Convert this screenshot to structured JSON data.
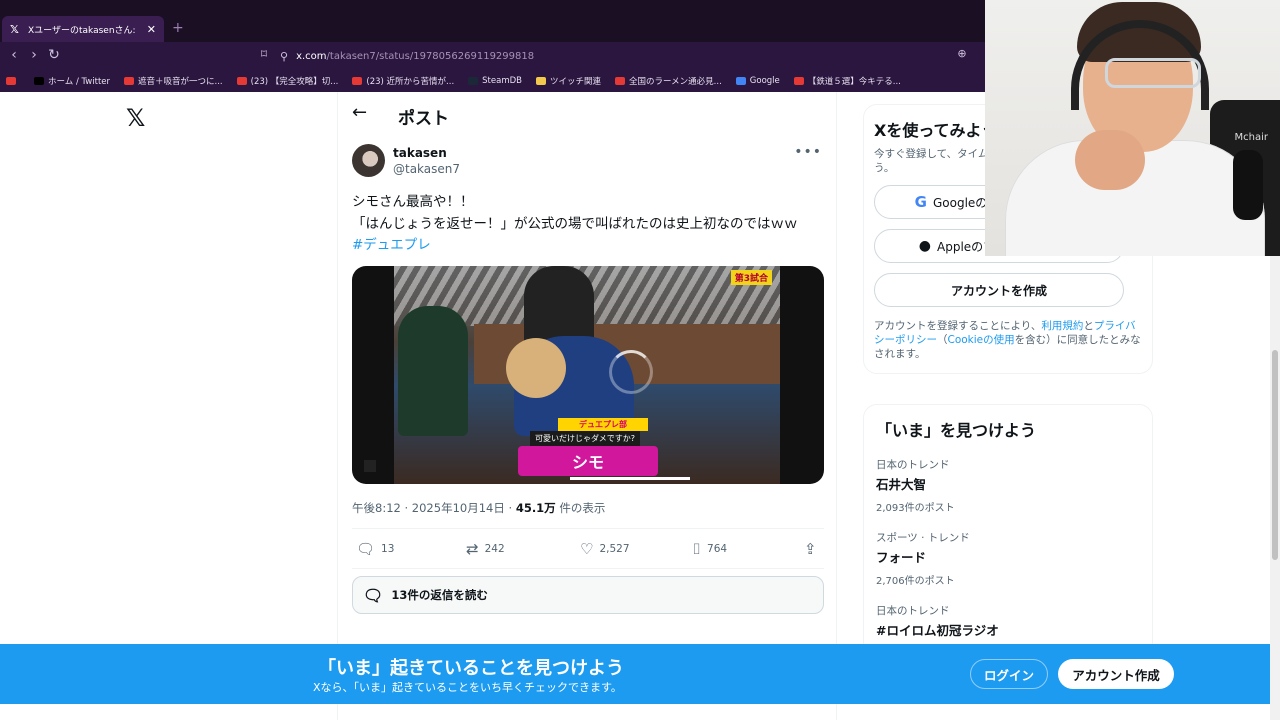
{
  "browser": {
    "tab_title": "Xユーザーのtakasenさん:「シモさん最",
    "url": "x.com/takasen7/status/1978056269119299818",
    "url_host": "x.com",
    "url_path": "/takasen7/status/1978056269119299818",
    "bookmarks": [
      {
        "label": "",
        "color": "#e53935"
      },
      {
        "label": "ホーム / Twitter",
        "color": "#000000"
      },
      {
        "label": "遮音＋吸音が一つに...",
        "color": "#e53935"
      },
      {
        "label": "(23) 【完全攻略】切...",
        "color": "#e53935"
      },
      {
        "label": "(23) 近所から苦情が...",
        "color": "#e53935"
      },
      {
        "label": "SteamDB",
        "color": "#1b2838"
      },
      {
        "label": "ツイッチ関連",
        "color": "#f2c94c"
      },
      {
        "label": "全国のラーメン通必見...",
        "color": "#e53935"
      },
      {
        "label": "Google",
        "color": "#4285f4"
      },
      {
        "label": "【鉄道５選】今キテる...",
        "color": "#e53935"
      }
    ]
  },
  "header": {
    "title": "ポスト"
  },
  "post": {
    "author_name": "takasen",
    "author_handle": "@takasen7",
    "text_line1": "シモさん最高や！！",
    "text_line2": "「はんじょうを返せー！」が公式の場で叫ばれたのは史上初なのではｗｗ",
    "hashtag": "#デュエプレ",
    "media": {
      "badge": "第3試合",
      "caption_top": "デュエプレ部",
      "caption_mid": "可愛いだけじゃダメですか?",
      "caption_name": "シモ"
    },
    "time": "午後8:12",
    "date": "2025年10月14日",
    "views": "45.1万",
    "views_label": "件の表示",
    "separator": " · ",
    "replies": "13",
    "reposts": "242",
    "likes": "2,527",
    "bookmarks": "764",
    "read_replies": "13件の返信を読む"
  },
  "signup": {
    "title": "Xを使ってみよう",
    "subtitle": "今すぐ登録して、タイムラインをカスタマイズしましょう。",
    "google_label": "Googleのアカウントで登録",
    "apple_label": "Appleのアカウントで登録",
    "create_label": "アカウントを作成",
    "terms_prefix": "アカウントを登録することにより、",
    "terms_link": "利用規約",
    "terms_and": "と",
    "privacy_link": "プライバシーポリシー",
    "cookie_open": "（",
    "cookie_link": "Cookieの使用",
    "terms_suffix": "を含む）に同意したとみなされます。"
  },
  "trends": {
    "title": "「いま」を見つけよう",
    "items": [
      {
        "category": "日本のトレンド",
        "name": "石井大智",
        "count": "2,093件のポスト"
      },
      {
        "category": "スポーツ · トレンド",
        "name": "フォード",
        "count": "2,706件のポスト"
      },
      {
        "category": "日本のトレンド",
        "name": "#ロイロム初冠ラジオ",
        "count": ""
      }
    ]
  },
  "banner": {
    "title": "「いま」起きていることを見つけよう",
    "subtitle": "Xなら、「いま」起きていることをいち早くチェックできます。",
    "login": "ログイン",
    "create": "アカウント作成"
  },
  "webcam": {
    "chair_text": "Mchair"
  },
  "colors": {
    "accent": "#1d9bf0",
    "chrome": "#2b1640",
    "text": "#0f1419",
    "muted": "#536471"
  },
  "icons": [
    "x-logo-icon",
    "back-arrow-icon",
    "more-icon",
    "reply-icon",
    "repost-icon",
    "like-icon",
    "bookmark-icon",
    "share-icon",
    "google-icon",
    "apple-icon",
    "replies-bubble-icon"
  ]
}
